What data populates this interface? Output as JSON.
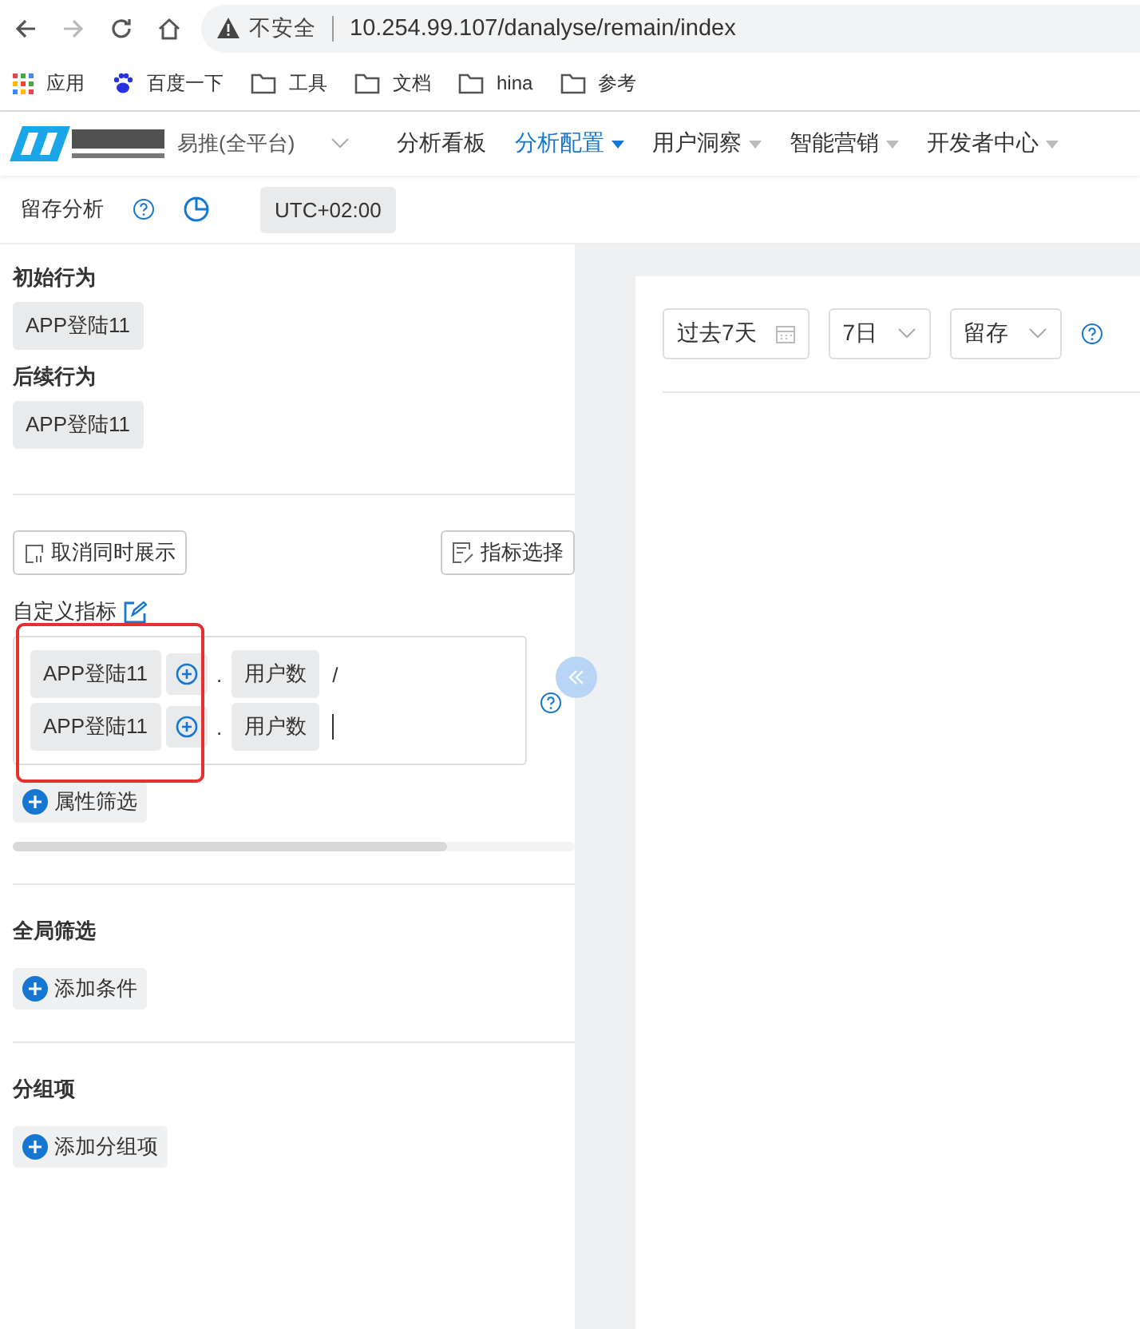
{
  "browser": {
    "security": "不安全",
    "url": "10.254.99.107/danalyse/remain/index",
    "bookmarks": [
      {
        "kind": "apps",
        "label": "应用"
      },
      {
        "kind": "paw",
        "label": "百度一下"
      },
      {
        "kind": "folder",
        "label": "工具"
      },
      {
        "kind": "folder",
        "label": "文档"
      },
      {
        "kind": "folder",
        "label": "hina"
      },
      {
        "kind": "folder",
        "label": "参考"
      }
    ]
  },
  "app": {
    "project": "易推(全平台)",
    "nav": [
      {
        "label": "分析看板",
        "selected": false,
        "has_menu": false
      },
      {
        "label": "分析配置",
        "selected": true,
        "has_menu": true
      },
      {
        "label": "用户洞察",
        "selected": false,
        "has_menu": true
      },
      {
        "label": "智能营销",
        "selected": false,
        "has_menu": true
      },
      {
        "label": "开发者中心",
        "selected": false,
        "has_menu": true
      }
    ]
  },
  "page": {
    "title": "留存分析",
    "timezone": "UTC+02:00"
  },
  "left": {
    "initial_label": "初始行为",
    "initial_event": "APP登陆11",
    "followup_label": "后续行为",
    "followup_event": "APP登陆11",
    "cancel_button": "取消同时展示",
    "metric_button": "指标选择",
    "custom_label": "自定义指标",
    "formula": [
      {
        "event": "APP登陆11",
        "dot": ".",
        "measure": "用户数",
        "operator": "/",
        "cursor": false
      },
      {
        "event": "APP登陆11",
        "dot": ".",
        "measure": "用户数",
        "cursor": true
      }
    ],
    "attr_filter": "属性筛选",
    "global_label": "全局筛选",
    "add_condition": "添加条件",
    "group_label": "分组项",
    "add_group": "添加分组项"
  },
  "right": {
    "date_range": "过去7天",
    "period": "7日",
    "metric": "留存"
  }
}
